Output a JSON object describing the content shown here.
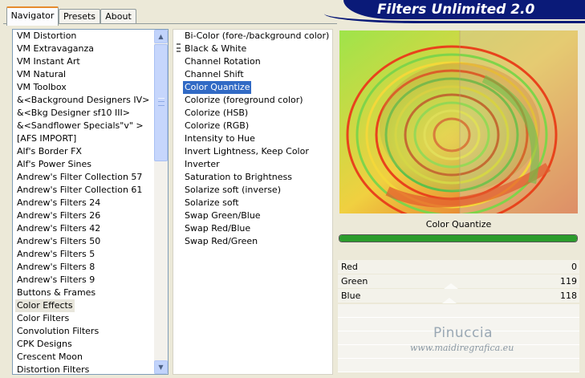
{
  "app": {
    "title": "Filters Unlimited 2.0"
  },
  "tabs": [
    {
      "label": "Navigator",
      "active": true
    },
    {
      "label": "Presets",
      "active": false
    },
    {
      "label": "About",
      "active": false
    }
  ],
  "filter_list": {
    "items": [
      "VM Distortion",
      "VM Extravaganza",
      "VM Instant Art",
      "VM Natural",
      "VM Toolbox",
      "&<Background Designers IV>",
      "&<Bkg Designer sf10 III>",
      "&<Sandflower Specials\"v\" >",
      "[AFS IMPORT]",
      "Alf's Border FX",
      "Alf's Power Sines",
      "Andrew's Filter Collection 57",
      "Andrew's Filter Collection 61",
      "Andrew's Filters 24",
      "Andrew's Filters 26",
      "Andrew's Filters 42",
      "Andrew's Filters 50",
      "Andrew's Filters 5",
      "Andrew's Filters 8",
      "Andrew's Filters 9",
      "Buttons & Frames",
      "Color Effects",
      "Color Filters",
      "Convolution Filters",
      "CPK Designs",
      "Crescent Moon",
      "Distortion Filters"
    ],
    "selected": "Color Effects",
    "scroll_up_icon": "arrow-up-icon",
    "scroll_down_icon": "arrow-down-icon"
  },
  "effect_list": {
    "items": [
      "Bi-Color (fore-/background color)",
      "Black & White",
      "Channel Rotation",
      "Channel Shift",
      "Color Quantize",
      "Colorize (foreground color)",
      "Colorize (HSB)",
      "Colorize (RGB)",
      "Intensity to Hue",
      "Invert Lightness, Keep Color",
      "Inverter",
      "Saturation to Brightness",
      "Solarize soft (inverse)",
      "Solarize soft",
      "Swap Green/Blue",
      "Swap Red/Blue",
      "Swap Red/Green"
    ],
    "selected": "Color Quantize",
    "category_marker_icon": "category-marker-icon"
  },
  "preview": {
    "effect_name": "Color Quantize",
    "progress": 1.0
  },
  "sliders": [
    {
      "label": "Red",
      "value": "0",
      "level": 0.0
    },
    {
      "label": "Green",
      "value": "119",
      "level": 0.467
    },
    {
      "label": "Blue",
      "value": "118",
      "level": 0.463
    }
  ],
  "watermark": {
    "name": "Pinuccia",
    "url": "www.maidiregrafica.eu"
  },
  "colors": {
    "selection": "#316ac5",
    "logo_bg": "#0a1a78",
    "progress": "#2b9c2b"
  }
}
